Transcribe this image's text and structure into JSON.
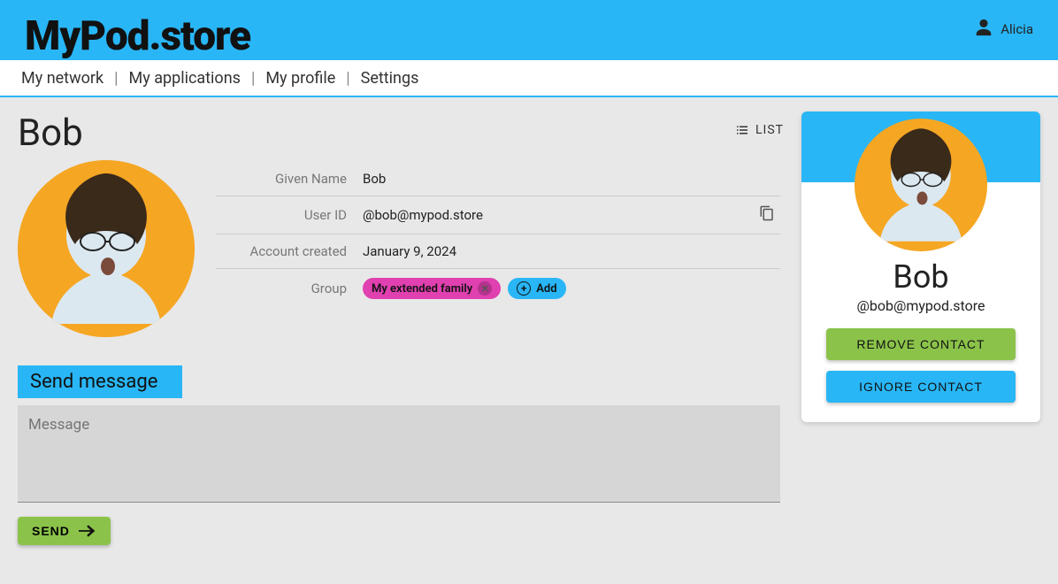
{
  "header": {
    "logo": "MyPod.store",
    "user_name": "Alicia"
  },
  "nav": {
    "items": [
      "My network",
      "My applications",
      "My profile",
      "Settings"
    ]
  },
  "list_link": "LIST",
  "profile": {
    "title": "Bob",
    "fields": {
      "given_name_label": "Given Name",
      "given_name_value": "Bob",
      "user_id_label": "User ID",
      "user_id_value": "@bob@mypod.store",
      "account_created_label": "Account created",
      "account_created_value": "January 9, 2024",
      "group_label": "Group"
    },
    "group_chip": "My extended family",
    "add_chip": "Add"
  },
  "message": {
    "header": "Send message",
    "placeholder": "Message",
    "send_label": "SEND"
  },
  "card": {
    "name": "Bob",
    "id": "@bob@mypod.store",
    "remove_label": "REMOVE CONTACT",
    "ignore_label": "IGNORE CONTACT"
  }
}
